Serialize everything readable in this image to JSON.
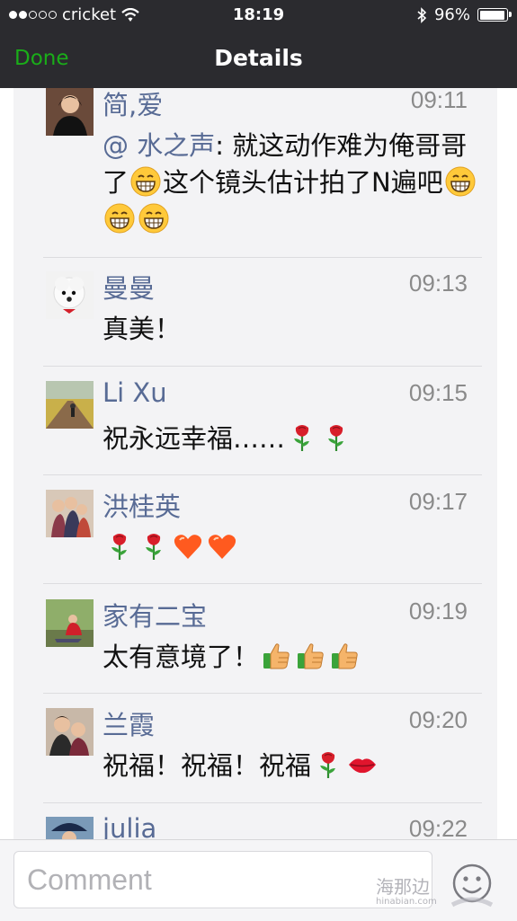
{
  "status_bar": {
    "carrier": "cricket",
    "time": "18:19",
    "battery_percent": "96%",
    "battery_level": 0.96,
    "signal_bars": 2
  },
  "nav": {
    "done_label": "Done",
    "title": "Details"
  },
  "comments": [
    {
      "name": "简,爱",
      "time": "09:11",
      "text_mention": "@ 水之声",
      "text_before": ": 就这动作难为俺哥哥了",
      "text_middle": "这个镜头估计拍了N遍吧",
      "emojis": [
        "grin-emoji",
        "grin-emoji",
        "grin-emoji",
        "grin-emoji"
      ]
    },
    {
      "name": "曼曼",
      "time": "09:13",
      "text": "真美！"
    },
    {
      "name": "Li Xu",
      "time": "09:15",
      "text": "祝永远幸福……",
      "emojis": [
        "rose-emoji",
        "rose-emoji"
      ]
    },
    {
      "name": "洪桂英",
      "time": "09:17",
      "text": "",
      "emojis": [
        "rose-emoji",
        "rose-emoji",
        "heart-emoji",
        "heart-emoji"
      ]
    },
    {
      "name": "家有二宝",
      "time": "09:19",
      "text": "太有意境了！",
      "emojis": [
        "thumbs-up-emoji",
        "thumbs-up-emoji",
        "thumbs-up-emoji"
      ]
    },
    {
      "name": "兰霞",
      "time": "09:20",
      "text": "祝福！祝福！祝福",
      "emojis": [
        "rose-emoji",
        "lips-emoji"
      ]
    },
    {
      "name": "julia",
      "time": "09:22"
    }
  ],
  "input": {
    "placeholder": "Comment"
  },
  "watermark": {
    "cn": "海那边",
    "en": "hinabian.com"
  },
  "colors": {
    "header_bg": "#2b2b2f",
    "accent_green": "#1aad19",
    "name_blue": "#586b95",
    "panel_bg": "#f3f3f5"
  }
}
